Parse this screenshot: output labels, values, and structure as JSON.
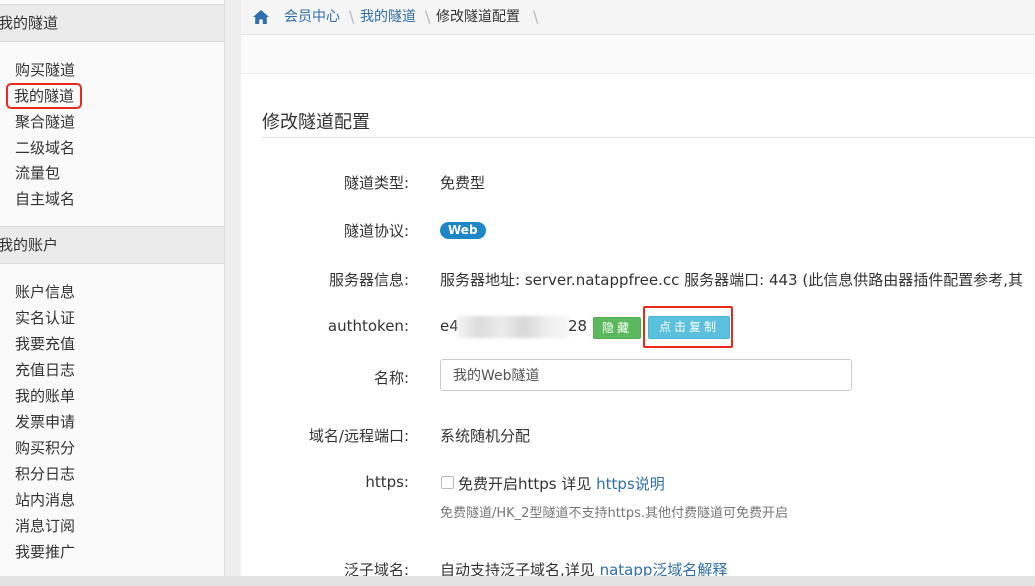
{
  "sidebar": {
    "section1_title": "我的隧道",
    "section1_items": [
      "购买隧道",
      "我的隧道",
      "聚合隧道",
      "二级域名",
      "流量包",
      "自主域名"
    ],
    "section2_title": "我的账户",
    "section2_items": [
      "账户信息",
      "实名认证",
      "我要充值",
      "充值日志",
      "我的账单",
      "发票申请",
      "购买积分",
      "积分日志",
      "站内消息",
      "消息订阅",
      "我要推广"
    ],
    "active_item": "我的隧道"
  },
  "breadcrumb": {
    "home_icon": "home-icon",
    "items": [
      "会员中心",
      "我的隧道",
      "修改隧道配置"
    ]
  },
  "form": {
    "title": "修改隧道配置",
    "type_label": "隧道类型:",
    "type_value": "免费型",
    "protocol_label": "隧道协议:",
    "protocol_badge": "Web",
    "server_label": "服务器信息:",
    "server_value": "服务器地址: server.natappfree.cc 服务器端口: 443 (此信息供路由器插件配置参考,其",
    "token_label": "authtoken:",
    "token_start": "e4",
    "token_end": "28",
    "hide_button": "隐藏",
    "copy_button": "点击复制",
    "name_label": "名称:",
    "name_value": "我的Web隧道",
    "port_label": "域名/远程端口:",
    "port_value": "系统随机分配",
    "https_label": "https:",
    "https_checkbox_text": "免费开启https 详见",
    "https_link": "https说明",
    "https_help": "免费隧道/HK_2型隧道不支持https.其他付费隧道可免费开启",
    "wildcard_label": "泛子域名:",
    "wildcard_text": "自动支持泛子域名,详见",
    "wildcard_link": "natapp泛域名解释"
  },
  "colors": {
    "link": "#2f6fab",
    "badge_web": "#1d87c7",
    "btn_hide": "#5cb85c",
    "btn_copy": "#5bc0de",
    "highlight": "#e8291c"
  }
}
